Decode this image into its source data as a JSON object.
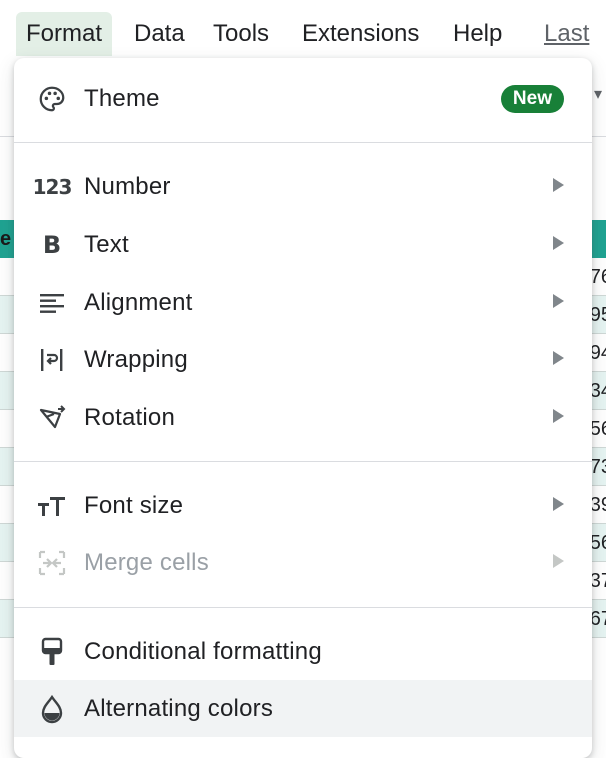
{
  "menubar": {
    "items": [
      {
        "label": "Format",
        "active": true
      },
      {
        "label": "Data"
      },
      {
        "label": "Tools"
      },
      {
        "label": "Extensions"
      },
      {
        "label": "Help"
      }
    ],
    "last_edit": "Last e"
  },
  "sheet": {
    "header_edge_text": "e",
    "row_values": [
      "76",
      "95",
      "94",
      "34",
      "56",
      "73",
      "39",
      "56",
      "37",
      "67"
    ]
  },
  "format_menu": {
    "theme": {
      "label": "Theme",
      "badge": "New",
      "icon": "palette-icon"
    },
    "number": {
      "label": "Number",
      "icon": "123-icon",
      "icon_text": "123"
    },
    "text": {
      "label": "Text",
      "icon": "bold-icon",
      "icon_text": "B"
    },
    "alignment": {
      "label": "Alignment",
      "icon": "align-left-icon"
    },
    "wrapping": {
      "label": "Wrapping",
      "icon": "wrap-text-icon"
    },
    "rotation": {
      "label": "Rotation",
      "icon": "text-rotation-icon"
    },
    "font_size": {
      "label": "Font size",
      "icon": "font-size-icon"
    },
    "merge_cells": {
      "label": "Merge cells",
      "icon": "merge-cells-icon",
      "disabled": true
    },
    "conditional_formatting": {
      "label": "Conditional formatting",
      "icon": "paint-roller-icon"
    },
    "alternating_colors": {
      "label": "Alternating colors",
      "icon": "color-drop-icon",
      "highlighted": true
    }
  },
  "colors": {
    "badge_green": "#188038",
    "header_teal": "#1fa392",
    "alt_row": "#e6f4f2",
    "highlight": "#f1f3f4"
  }
}
